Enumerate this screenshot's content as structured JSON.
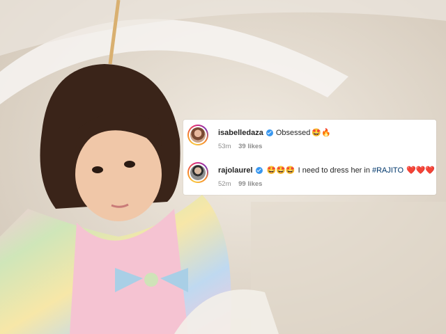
{
  "comments": [
    {
      "username": "isabelledaza",
      "text": "Obsessed",
      "emoji": "🤩🔥",
      "time": "53m",
      "likes": "39 likes"
    },
    {
      "username": "rajolaurel",
      "emoji_prefix": "🤩🤩🤩",
      "text": "I need to dress her in",
      "hashtag": "#RAJITO",
      "emoji_suffix": "❤️❤️❤️",
      "time": "52m",
      "likes": "99 likes"
    }
  ],
  "colors": {
    "verified": "#3897f0",
    "hashtag": "#00376b",
    "meta_text": "#8e8e8e",
    "heart": "#ed4956"
  }
}
